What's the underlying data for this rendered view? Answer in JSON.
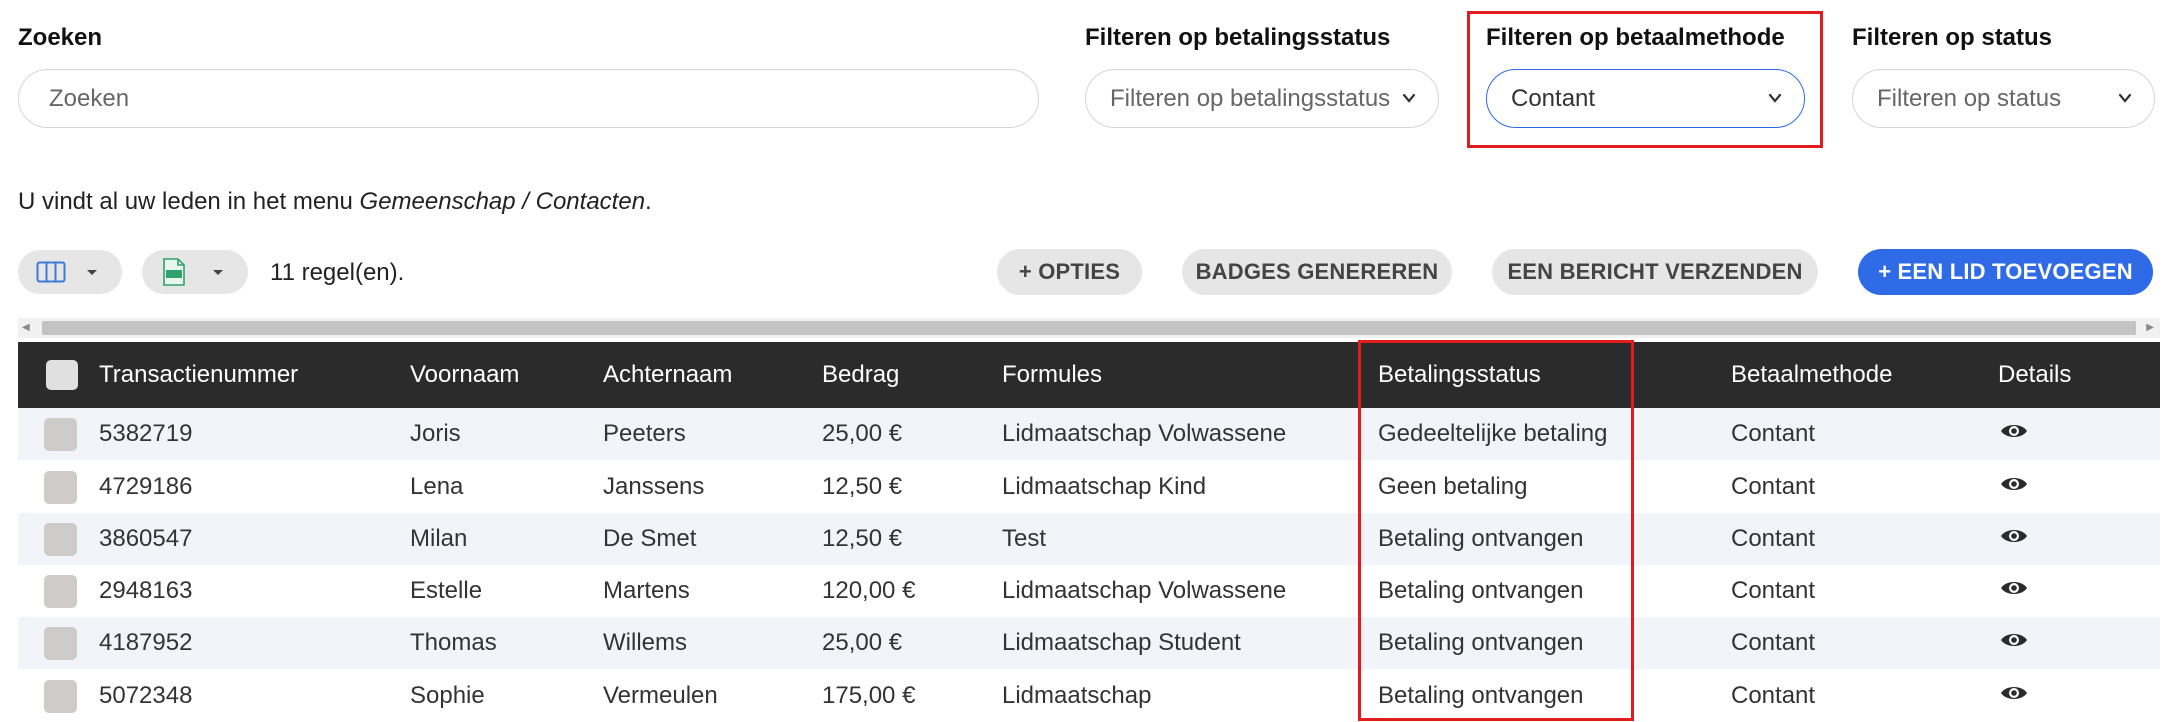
{
  "filters": {
    "search": {
      "label": "Zoeken",
      "placeholder": "Zoeken"
    },
    "payment_status": {
      "label": "Filteren op betalingsstatus",
      "value": "Filteren op betalingsstatus"
    },
    "payment_method": {
      "label": "Filteren op betaalmethode",
      "value": "Contant"
    },
    "status": {
      "label": "Filteren op status",
      "value": "Filteren op status"
    }
  },
  "info": {
    "text": "U vindt al uw leden in het menu ",
    "menu_path": "Gemeenschap / Contacten",
    "suffix": "."
  },
  "toolbar": {
    "columns_icon": "columns-icon",
    "export_icon": "excel-export-icon",
    "row_count": "11 regel(en).",
    "options_label": "+ OPTIES",
    "badges_label": "BADGES GENEREREN",
    "message_label": "EEN BERICHT VERZENDEN",
    "add_member_label": "+ EEN LID TOEVOEGEN"
  },
  "colors": {
    "accent": "#2f6be6",
    "highlight": "#e21c1c",
    "header_bg": "#2b2b2b",
    "stripe": "#f1f5fa"
  },
  "table": {
    "columns": [
      "Transactienummer",
      "Voornaam",
      "Achternaam",
      "Bedrag",
      "Formules",
      "Betalingsstatus",
      "Betaalmethode",
      "Details"
    ],
    "rows": [
      [
        "5382719",
        "Joris",
        "Peeters",
        "25,00 €",
        "Lidmaatschap Volwassene",
        "Gedeeltelijke betaling",
        "Contant"
      ],
      [
        "4729186",
        "Lena",
        "Janssens",
        "12,50 €",
        "Lidmaatschap Kind",
        "Geen betaling",
        "Contant"
      ],
      [
        "3860547",
        "Milan",
        "De Smet",
        "12,50 €",
        "Test",
        "Betaling ontvangen",
        "Contant"
      ],
      [
        "2948163",
        "Estelle",
        "Martens",
        "120,00 €",
        "Lidmaatschap Volwassene",
        "Betaling ontvangen",
        "Contant"
      ],
      [
        "4187952",
        "Thomas",
        "Willems",
        "25,00 €",
        "Lidmaatschap Student",
        "Betaling ontvangen",
        "Contant"
      ],
      [
        "5072348",
        "Sophie",
        "Vermeulen",
        "175,00 €",
        "Lidmaatschap",
        "Betaling ontvangen",
        "Contant"
      ]
    ],
    "details_icon": "eye-icon"
  }
}
